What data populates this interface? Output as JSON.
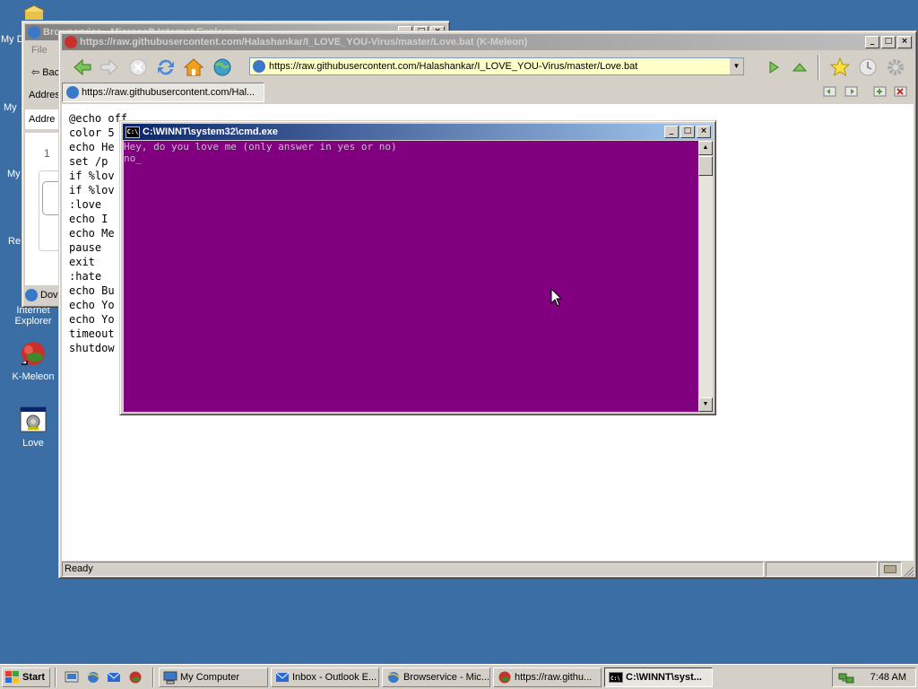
{
  "desktop": {
    "partial_labels": [
      "My D",
      "My",
      "My",
      "Re"
    ],
    "icons": [
      {
        "label_line1": "Internet",
        "label_line2": "Explorer"
      },
      {
        "label_line1": "K-Meleon",
        "label_line2": ""
      },
      {
        "label_line1": "Love",
        "label_line2": ""
      }
    ]
  },
  "ie_window": {
    "title": "Browservice - Microsoft Internet Explorer",
    "menu_file": "File",
    "back_label": "Bac",
    "address_label": "Addres",
    "address_label2": "Addre",
    "line_number": "1",
    "status": "Dov"
  },
  "kmeleon": {
    "title": "https://raw.githubusercontent.com/Halashankar/I_LOVE_YOU-Virus/master/Love.bat (K-Meleon)",
    "url": "https://raw.githubusercontent.com/Halashankar/I_LOVE_YOU-Virus/master/Love.bat",
    "tab_label": "https://raw.githubusercontent.com/Hal...",
    "status": "Ready",
    "code_lines": [
      "@echo off",
      "color 5",
      "echo He",
      "set /p",
      "if %lov",
      "if %lov",
      ":love",
      "echo I",
      "echo Me",
      "pause",
      "exit",
      ":hate",
      "echo Bu",
      "echo Yo",
      "echo Yo",
      "timeout",
      "shutdow"
    ]
  },
  "cmd": {
    "title": "C:\\WINNT\\system32\\cmd.exe",
    "lines": [
      "Hey, do you love me (only answer in yes or no)",
      "no_"
    ],
    "bg_color": "#800080"
  },
  "taskbar": {
    "start_label": "Start",
    "tasks": [
      {
        "label": "My Computer",
        "icon": "computer-icon"
      },
      {
        "label": "Inbox - Outlook E...",
        "icon": "outlook-icon"
      },
      {
        "label": "Browservice - Mic...",
        "icon": "ie-icon"
      },
      {
        "label": "https://raw.githu...",
        "icon": "kmeleon-icon"
      },
      {
        "label": "C:\\WINNT\\syst...",
        "icon": "cmd-icon"
      }
    ],
    "clock": "7:48 AM"
  }
}
